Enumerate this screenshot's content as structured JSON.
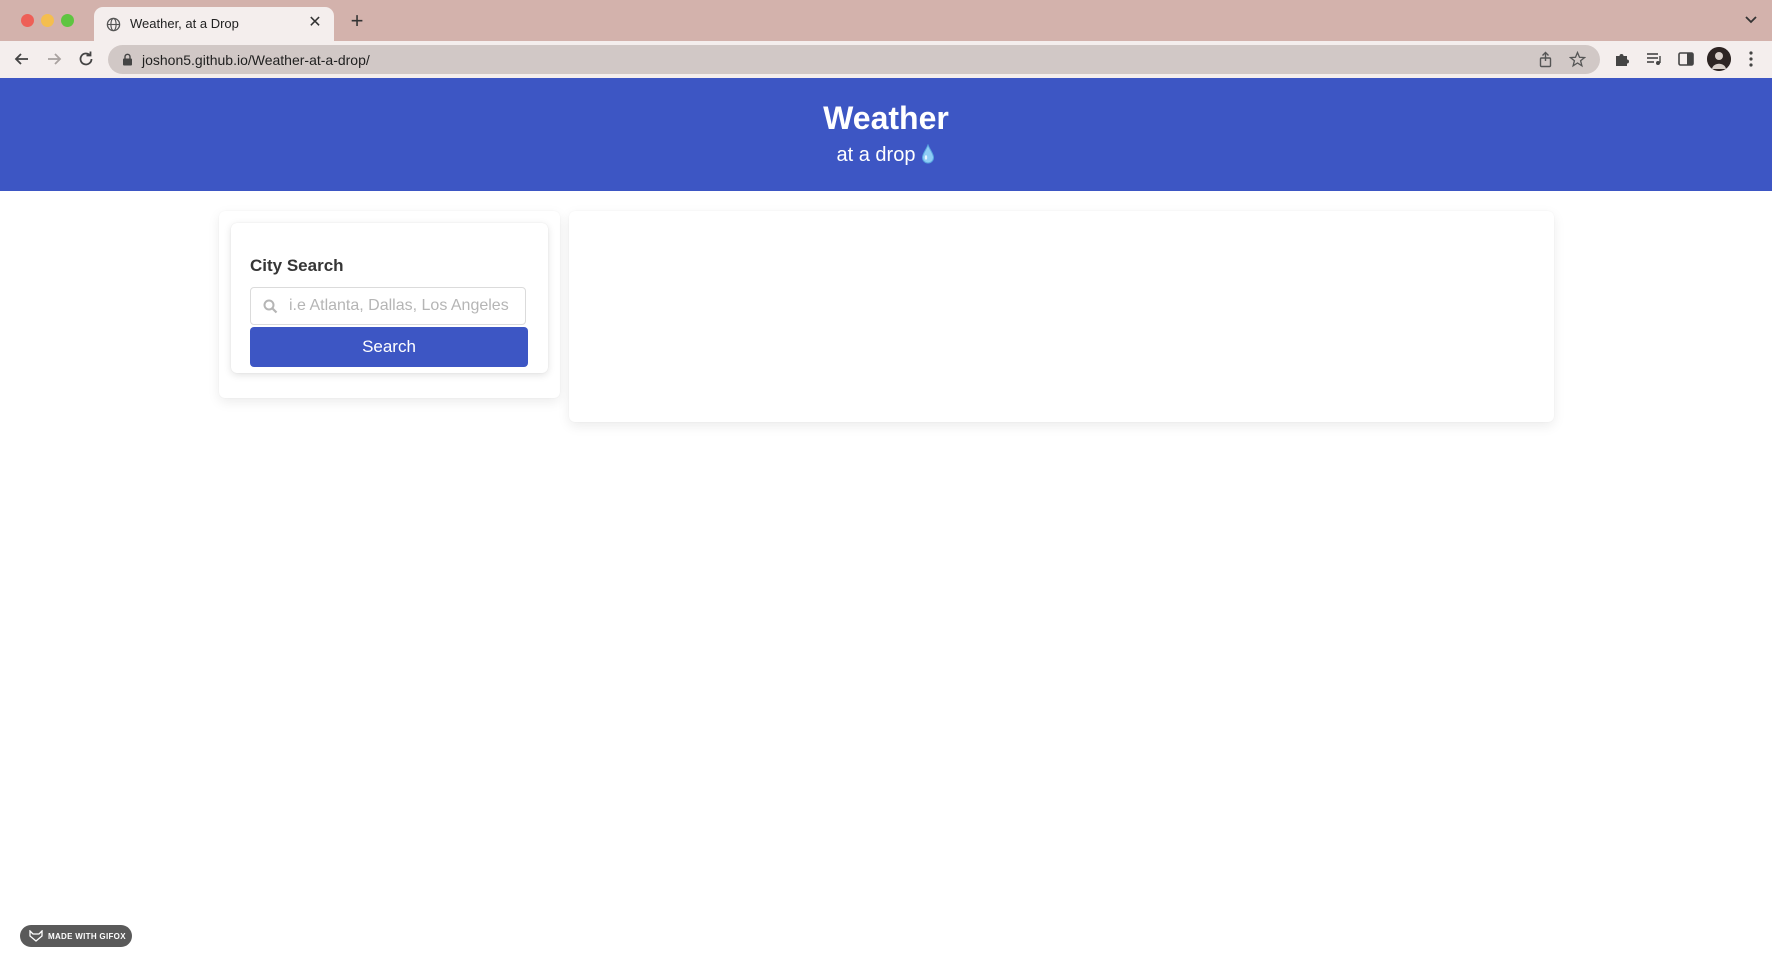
{
  "browser": {
    "tab_title": "Weather, at a Drop",
    "url": "joshon5.github.io/Weather-at-a-drop/"
  },
  "header": {
    "title": "Weather",
    "subtitle": "at a drop"
  },
  "search_card": {
    "title": "City Search",
    "input_placeholder": "i.e Atlanta, Dallas, Los Angeles",
    "input_value": "",
    "button_label": "Search"
  },
  "badge": {
    "label": "MADE WITH GIFOX"
  },
  "colors": {
    "brand": "#3d56c4",
    "tabbar": "#d3b2ac"
  },
  "icons": [
    "globe-icon",
    "close-icon",
    "plus-icon",
    "chevron-down-icon",
    "back-arrow-icon",
    "forward-arrow-icon",
    "reload-icon",
    "lock-icon",
    "share-icon",
    "star-icon",
    "puzzle-icon",
    "media-icon",
    "sidebar-icon",
    "avatar",
    "kebab-menu-icon",
    "water-drop-icon",
    "search-icon",
    "fox-icon"
  ]
}
